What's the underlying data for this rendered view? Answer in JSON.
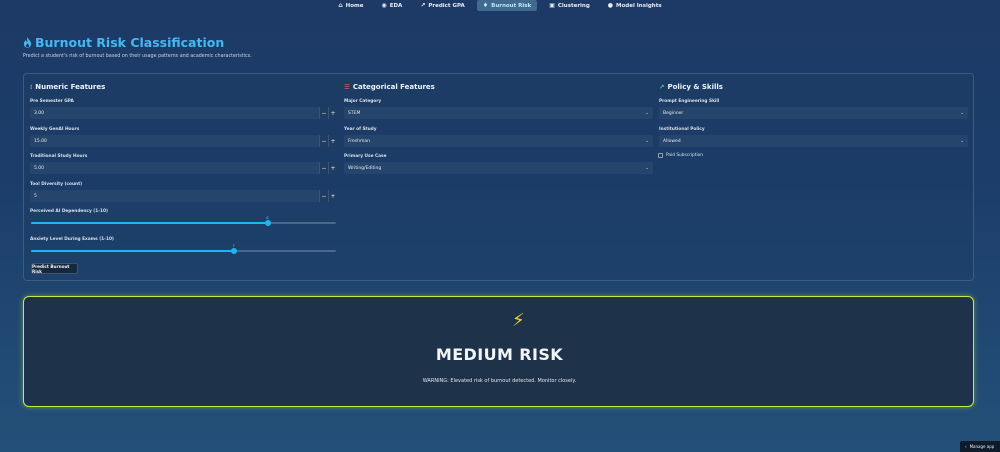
{
  "nav": {
    "items": [
      {
        "label": "Home",
        "icon": "home-icon"
      },
      {
        "label": "EDA",
        "icon": "globe-icon"
      },
      {
        "label": "Predict GPA",
        "icon": "trend-icon"
      },
      {
        "label": "Burnout Risk",
        "icon": "flame-icon",
        "active": true
      },
      {
        "label": "Clustering",
        "icon": "grid-icon"
      },
      {
        "label": "Model Insights",
        "icon": "brain-icon"
      }
    ]
  },
  "header": {
    "title": "Burnout Risk Classification",
    "subtitle": "Predict a student's risk of burnout based on their usage patterns and academic characteristics."
  },
  "numeric": {
    "heading": "Numeric Features",
    "pre_gpa": {
      "label": "Pre Semester GPA",
      "value": "3.00"
    },
    "weekly_genai": {
      "label": "Weekly GenAI Hours",
      "value": "15.00"
    },
    "traditional_study": {
      "label": "Traditional Study Hours",
      "value": "5.00"
    },
    "tool_diversity": {
      "label": "Tool Diversity (count)",
      "value": "5"
    },
    "ai_dependency": {
      "label": "Perceived AI Dependency (1-10)",
      "value": "8",
      "min": 1,
      "max": 10
    },
    "anxiety": {
      "label": "Anxiety Level During Exams (1-10)",
      "value": "7",
      "min": 1,
      "max": 10
    },
    "predict_button": "Predict Burnout Risk"
  },
  "categorical": {
    "heading": "Categorical Features",
    "major": {
      "label": "Major Category",
      "value": "STEM"
    },
    "year": {
      "label": "Year of Study",
      "value": "Freshman"
    },
    "use_case": {
      "label": "Primary Use Case",
      "value": "Writing/Editing"
    }
  },
  "policy": {
    "heading": "Policy & Skills",
    "prompt_skill": {
      "label": "Prompt Engineering Skill",
      "value": "Beginner"
    },
    "inst_policy": {
      "label": "Institutional Policy",
      "value": "Allowed"
    },
    "paid_sub": {
      "label": "Paid Subscription"
    }
  },
  "result": {
    "level": "MEDIUM RISK",
    "message": "WARNING: Elevated risk of burnout detected. Monitor closely."
  },
  "footer": {
    "manage": "Manage app"
  },
  "colors": {
    "accent": "#20b4f0",
    "warning_border": "#c9e84a",
    "bolt": "#f7d12b"
  }
}
